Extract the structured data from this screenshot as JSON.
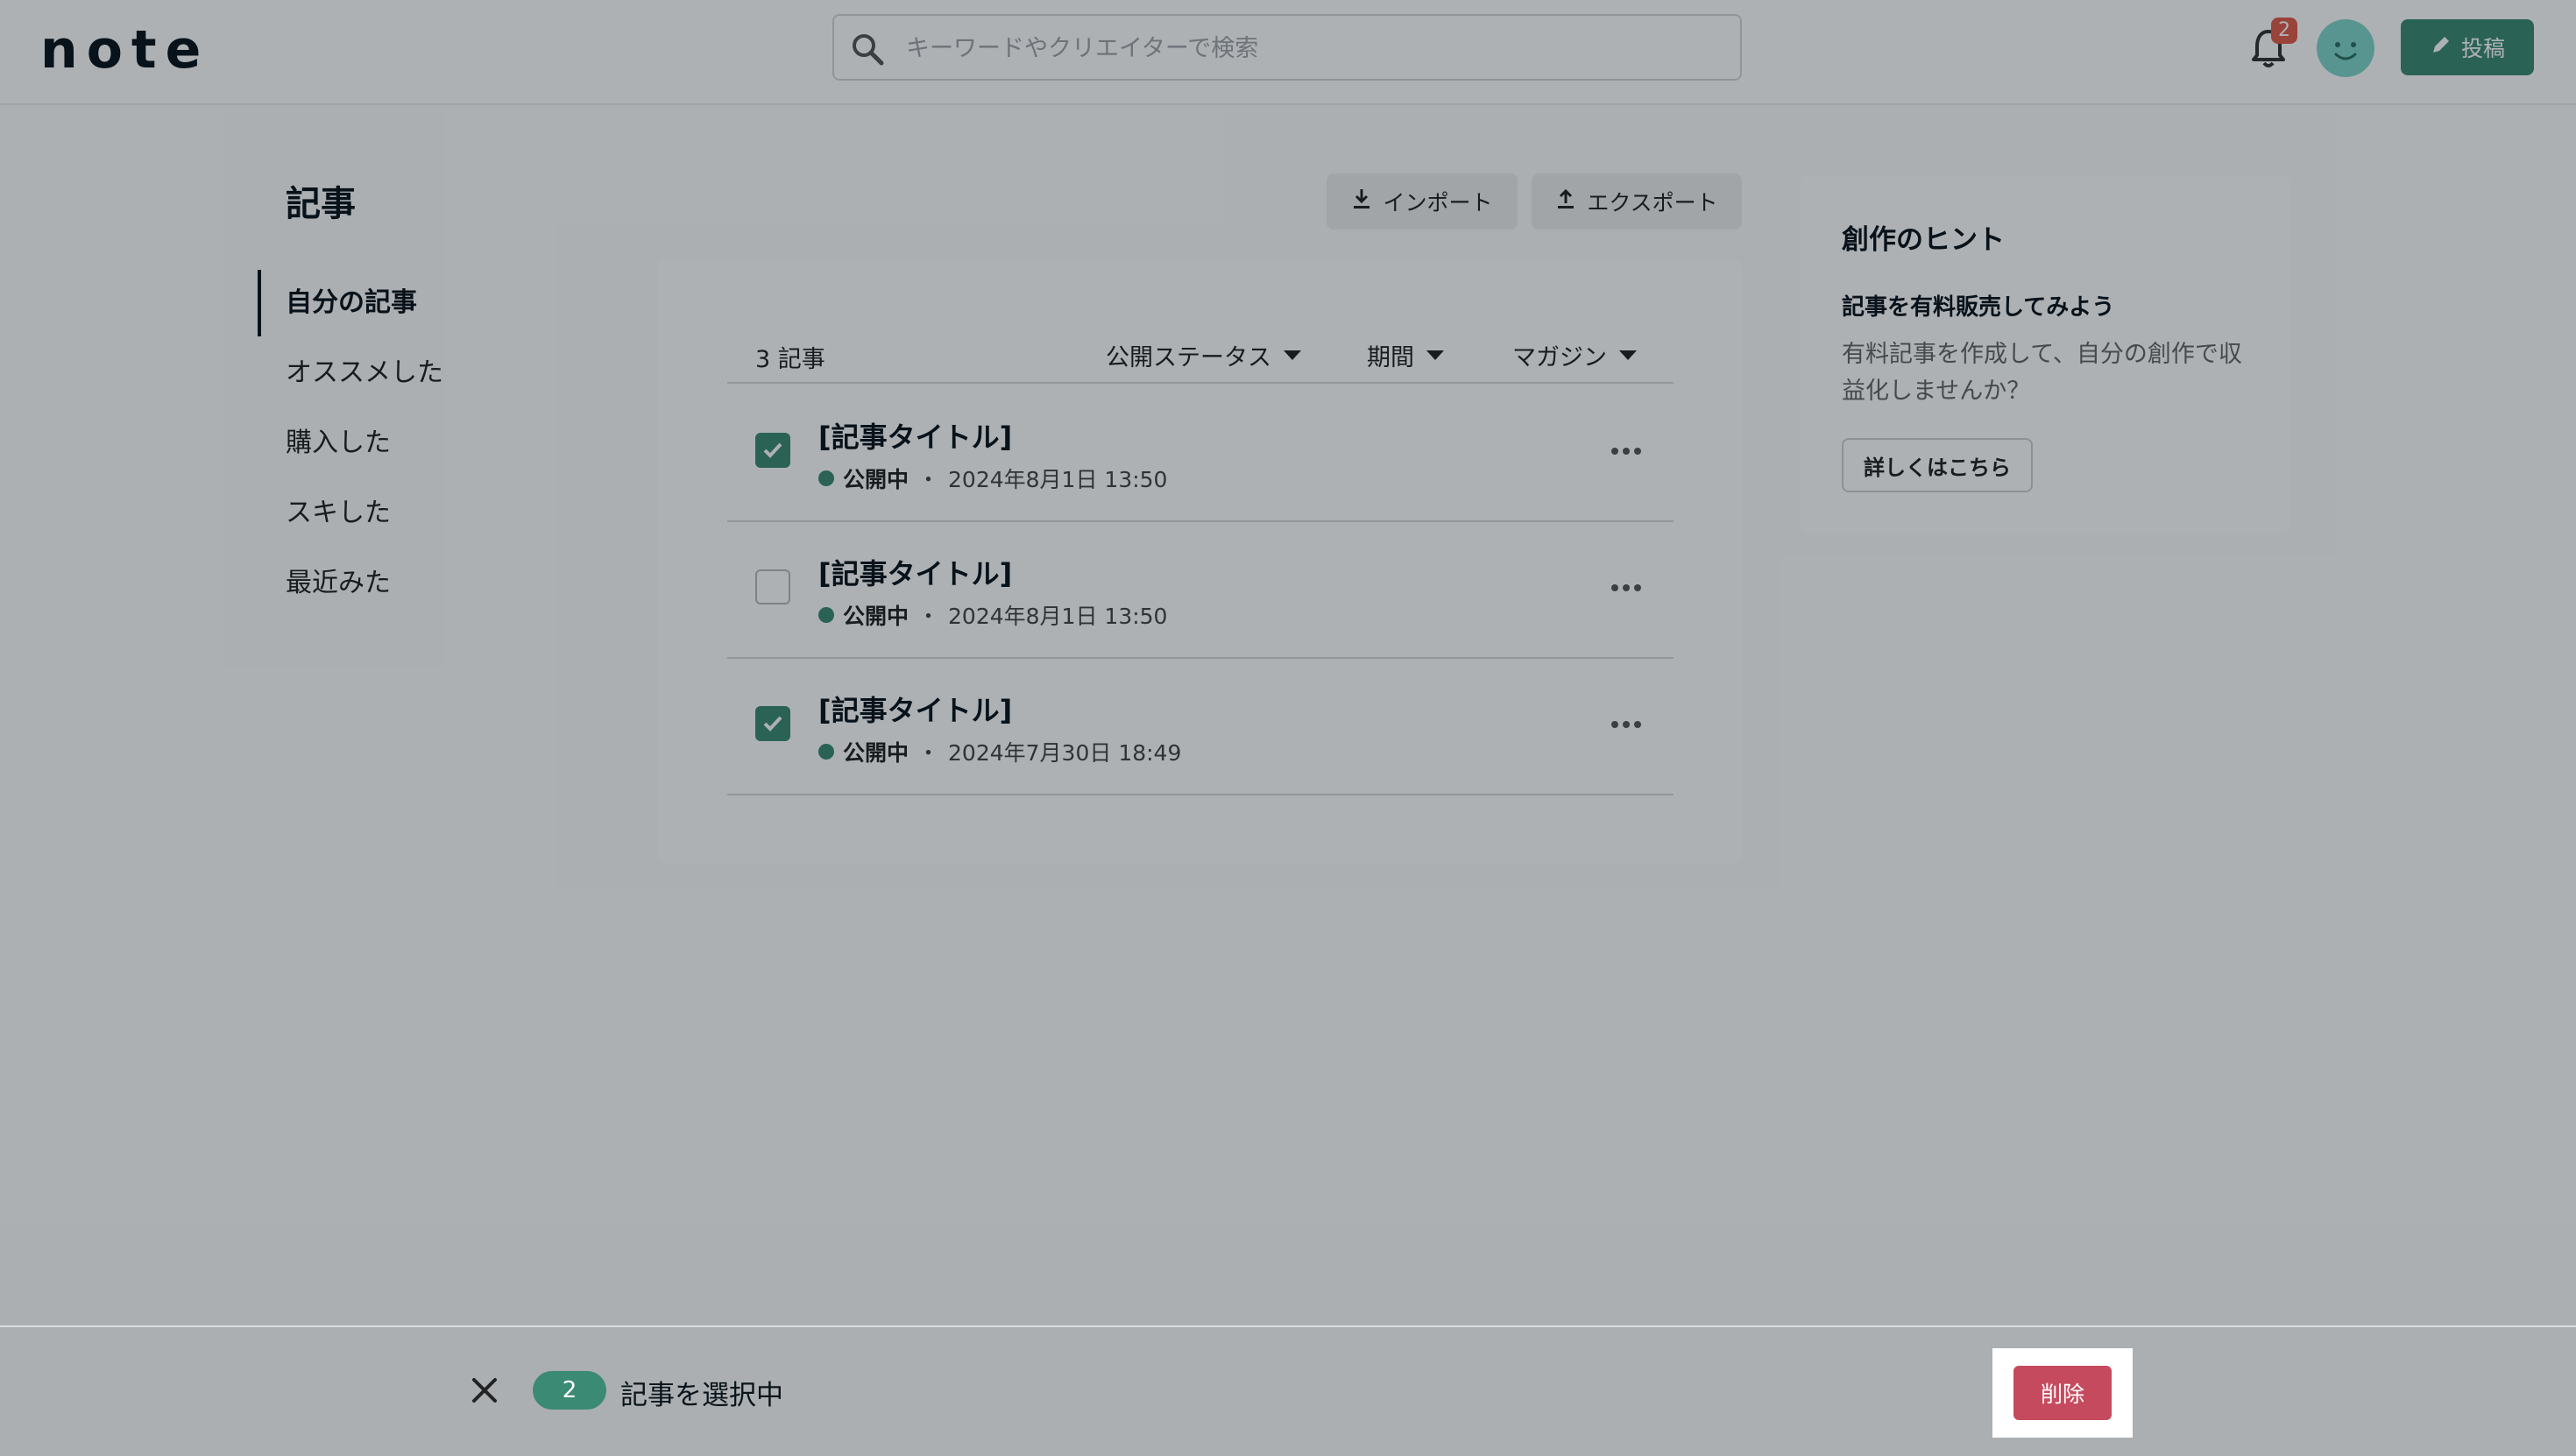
{
  "header": {
    "logo": "note",
    "search_placeholder": "キーワードやクリエイターで検索",
    "notification_count": "2",
    "post_button": "投稿"
  },
  "page": {
    "title": "記事",
    "nav": [
      "自分の記事",
      "オススメした",
      "購入した",
      "スキした",
      "最近みた"
    ]
  },
  "toolbar": {
    "import": "インポート",
    "export": "エクスポート"
  },
  "list": {
    "count": "3 記事",
    "filters": [
      "公開ステータス",
      "期間",
      "マガジン"
    ],
    "articles": [
      {
        "title": "[記事タイトル]",
        "status": "公開中",
        "separator": "・",
        "date": "2024年8月1日 13:50",
        "checked": true
      },
      {
        "title": "[記事タイトル]",
        "status": "公開中",
        "separator": "・",
        "date": "2024年8月1日 13:50",
        "checked": false
      },
      {
        "title": "[記事タイトル]",
        "status": "公開中",
        "separator": "・",
        "date": "2024年7月30日 18:49",
        "checked": true
      }
    ]
  },
  "hint": {
    "title": "創作のヒント",
    "subtitle": "記事を有料販売してみよう",
    "body": "有料記事を作成して、自分の創作で収益化しませんか？",
    "button": "詳しくはこちら"
  },
  "selection_bar": {
    "selected_count": "2",
    "selected_text": "記事を選択中",
    "delete_button": "削除"
  },
  "colors": {
    "brand": "#3b8a73",
    "danger": "#c64a5e",
    "badge": "#e05b4b",
    "overlay": "rgba(8,19,26,0.33)"
  }
}
